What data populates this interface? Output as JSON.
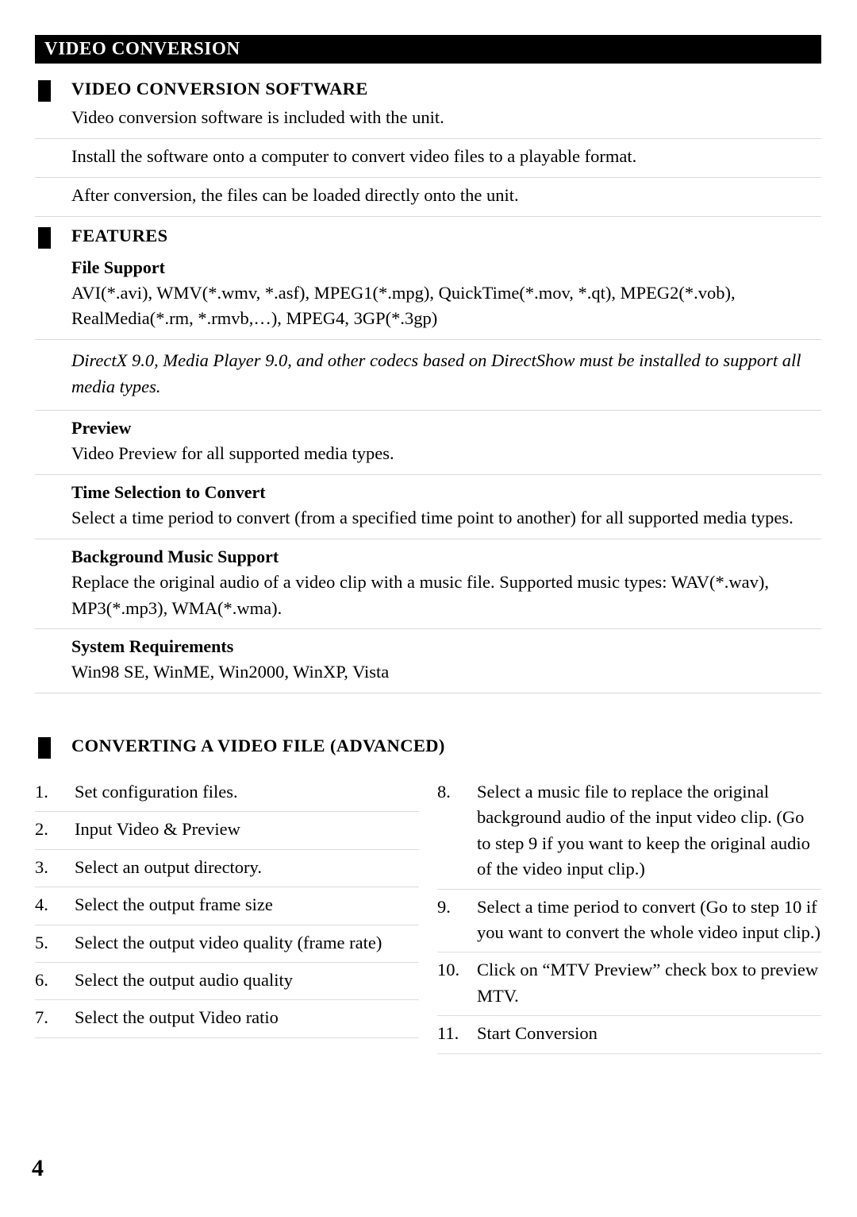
{
  "running_head": {
    "title": "VIDEO CONVERSION"
  },
  "sections": [
    {
      "heading": "VIDEO CONVERSION SOFTWARE",
      "paragraphs": [
        "Video conversion software is included with the unit.",
        "Install the software onto a computer to convert video files to a playable format.",
        "After conversion, the files can be loaded directly onto the unit."
      ]
    },
    {
      "heading": "FEATURES",
      "subsections": [
        {
          "title": "File Support",
          "body": "AVI(*.avi), WMV(*.wmv, *.asf), MPEG1(*.mpg), QuickTime(*.mov, *.qt), MPEG2(*.vob), RealMedia(*.rm, *.rmvb,…), MPEG4, 3GP(*.3gp)"
        },
        {
          "title": "",
          "note_italic": "DirectX 9.0, Media Player 9.0, and other codecs based on DirectShow must be installed to support all media types."
        },
        {
          "title": "Preview",
          "body": "Video Preview for all supported media types."
        },
        {
          "title": "Time Selection to Convert",
          "body": "Select a time period to convert (from a specified time point to another) for all supported media types."
        },
        {
          "title": "Background Music Support",
          "body": "Replace the original audio of a video clip with a music file. Supported music types: WAV(*.wav), MP3(*.mp3), WMA(*.wma)."
        },
        {
          "title": "System Requirements",
          "body": "Win98 SE, WinME, Win2000, WinXP, Vista"
        }
      ]
    },
    {
      "heading": "CONVERTING A VIDEO FILE (ADVANCED)"
    }
  ],
  "steps": {
    "left_column": [
      {
        "num": "1.",
        "text": "Set configuration files."
      },
      {
        "num": "2.",
        "text": "Input Video & Preview"
      },
      {
        "num": "3.",
        "text": "Select an output directory."
      },
      {
        "num": "4.",
        "text": "Select the output frame size"
      },
      {
        "num": "5.",
        "text": "Select the output video quality (frame rate)"
      },
      {
        "num": "6.",
        "text": "Select the output audio quality"
      },
      {
        "num": "7.",
        "text": "Select the output Video ratio"
      }
    ],
    "right_column": [
      {
        "num": "8.",
        "text": "Select a music file to replace the original background audio of the input video clip. (Go to step 9 if you want to keep the original audio of the video input clip.)"
      },
      {
        "num": "9.",
        "text": "Select a time period to convert (Go to step 10 if you want to convert the whole video input clip.)"
      },
      {
        "num": "10.",
        "text": "Click on “MTV Preview” check box to preview MTV."
      },
      {
        "num": "11.",
        "text": "Start Conversion"
      }
    ]
  },
  "folio": {
    "page_number": "4"
  },
  "colors": {
    "header_bar_background": "#000000",
    "header_bar_text": "#ffffff",
    "bullet": "#000000",
    "rule": "#d9d9d9",
    "page_background": "#ffffff",
    "text": "#000000"
  }
}
